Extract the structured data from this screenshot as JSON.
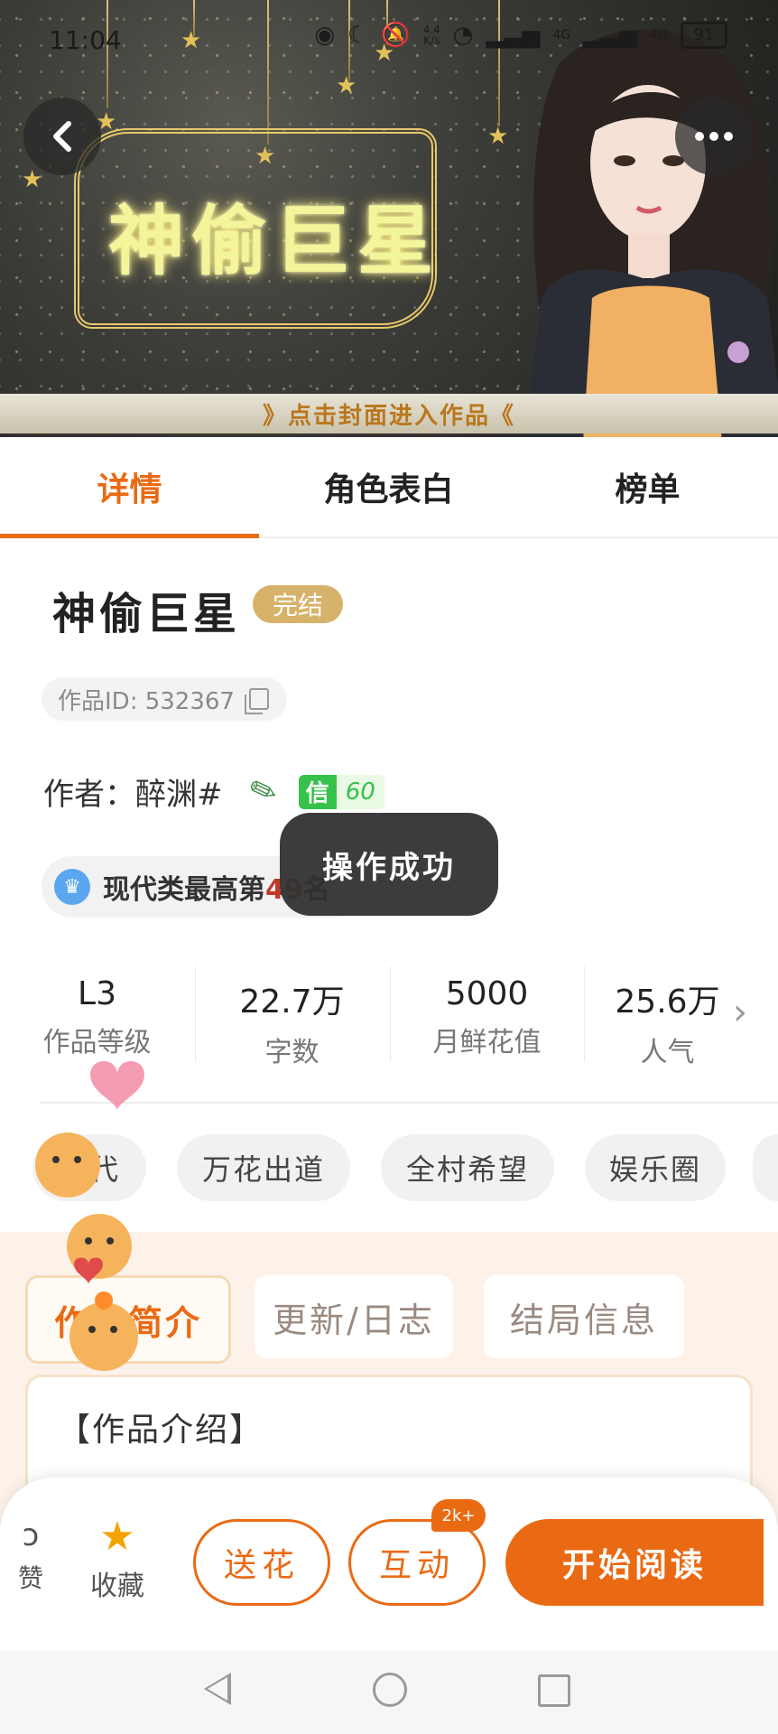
{
  "status_bar": {
    "time": "11:04",
    "net_speed_value": "4.4",
    "net_speed_unit": "K/s",
    "network_1": "4G",
    "network_2": "4G",
    "battery": "91"
  },
  "cover": {
    "title": "神偷巨星",
    "enter_hint": "》点击封面进入作品《"
  },
  "tabs": [
    {
      "label": "详情",
      "active": true
    },
    {
      "label": "角色表白",
      "active": false
    },
    {
      "label": "榜单",
      "active": false
    }
  ],
  "work": {
    "title": "神偷巨星",
    "status": "完结",
    "id_text": "作品ID: 532367",
    "author_label": "作者：醉渊#",
    "credit_key": "信",
    "credit_value": "60",
    "rank_prefix": "现代类最高第",
    "rank_number": "49",
    "rank_suffix": "名"
  },
  "toast": "操作成功",
  "stats": [
    {
      "value": "L3",
      "label": "作品等级"
    },
    {
      "value": "22.7万",
      "label": "字数"
    },
    {
      "value": "5000",
      "label": "月鲜花值"
    },
    {
      "value": "25.6万",
      "label": "人气"
    }
  ],
  "tags": [
    "现代",
    "万花出道",
    "全村希望",
    "娱乐圈"
  ],
  "intro_tabs": [
    {
      "label": "作品简介",
      "active": true
    },
    {
      "label": "更新/日志",
      "active": false
    },
    {
      "label": "结局信息",
      "active": false
    }
  ],
  "intro": {
    "heading": "【作品介绍】"
  },
  "actions": {
    "like_label": "赞",
    "favorite_label": "收藏",
    "send_flower_label": "送花",
    "interact_label": "互动",
    "interact_badge": "2k+",
    "start_reading_label": "开始阅读"
  },
  "colors": {
    "accent": "#ea6a14",
    "status_badge": "#d7b26a",
    "credit_green": "#36c14a",
    "favorite_star": "#f5a300"
  },
  "icons": {
    "back": "chevron-left-icon",
    "more": "more-dots-icon",
    "copy": "copy-icon",
    "pencil": "pencil-icon",
    "rank": "rank-badge-icon",
    "like": "thumb-up-icon",
    "favorite": "star-icon",
    "stats_more": "chevron-right-icon"
  }
}
